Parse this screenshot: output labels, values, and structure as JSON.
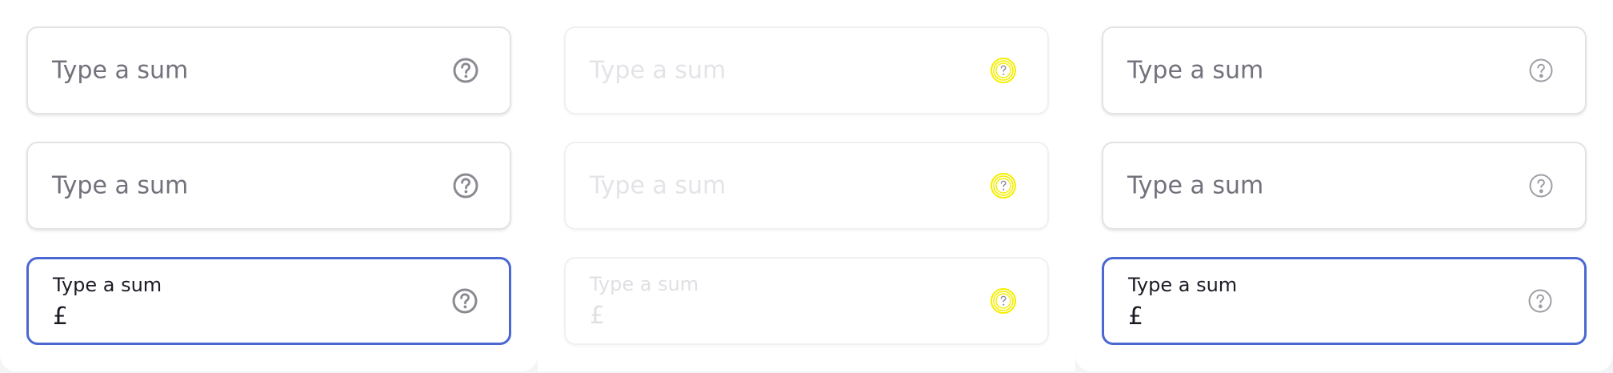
{
  "columns": [
    {
      "state": "default",
      "fields": [
        {
          "placeholder": "Type a sum",
          "icon": "help-icon"
        },
        {
          "placeholder": "Type a sum",
          "icon": "help-icon"
        },
        {
          "label": "Type a sum",
          "value": "£",
          "icon": "help-icon"
        }
      ]
    },
    {
      "state": "disabled",
      "fields": [
        {
          "placeholder": "Type a sum",
          "icon": "help-icon"
        },
        {
          "placeholder": "Type a sum",
          "icon": "help-icon"
        },
        {
          "label": "Type a sum",
          "value": "£",
          "icon": "help-icon"
        }
      ]
    },
    {
      "state": "outline",
      "fields": [
        {
          "placeholder": "Type a sum",
          "icon": "help-icon"
        },
        {
          "placeholder": "Type a sum",
          "icon": "help-icon"
        },
        {
          "label": "Type a sum",
          "value": "£",
          "icon": "help-icon"
        }
      ]
    }
  ],
  "colors": {
    "focus_border": "#4a67d2",
    "icon_default": "#8a8a92",
    "icon_disabled": "#f5ee00",
    "icon_outline": "#9e9ea6"
  }
}
